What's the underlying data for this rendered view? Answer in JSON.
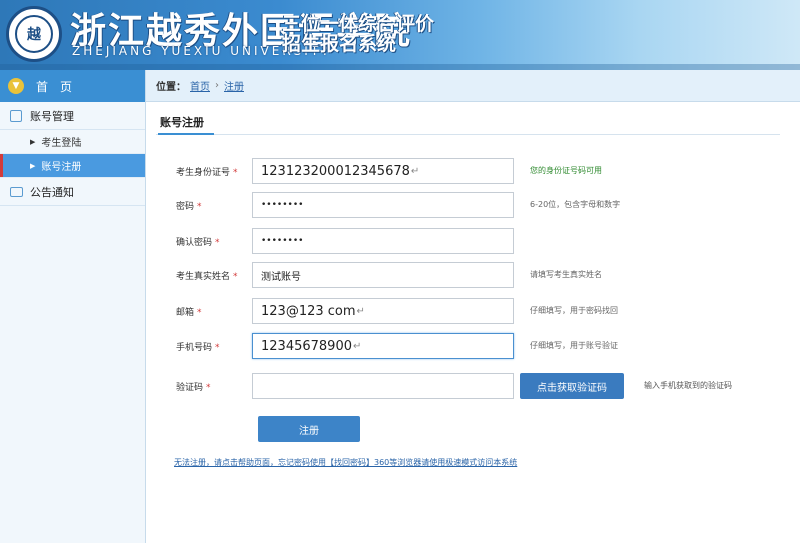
{
  "header": {
    "logo_text": "越",
    "school_cn": "浙江越秀外国语学院",
    "school_en": "ZHEJIANG YUEXIU UNIVERSITY",
    "system_title_line1": "三位一体综合评价",
    "system_title_line2": "招生报名系统"
  },
  "sidebar": {
    "home_label": "首页",
    "groups": [
      {
        "label": "账号管理",
        "items": [
          {
            "label": "考生登陆"
          },
          {
            "label": "账号注册"
          }
        ]
      },
      {
        "label": "公告通知"
      }
    ]
  },
  "breadcrumb": {
    "prefix": "位置：",
    "home": "首页",
    "sep": "›",
    "current": "注册"
  },
  "main": {
    "tab_title": "账号注册",
    "fields": [
      {
        "label": "考生身份证号",
        "value": "123123200012345678",
        "mark": "↵",
        "hint": "您的身份证号码可用"
      },
      {
        "label": "密码",
        "value": "••••••••",
        "hint": "6-20位，包含字母和数字"
      },
      {
        "label": "确认密码",
        "value": "••••••••",
        "hint": ""
      },
      {
        "label": "考生真实姓名",
        "value": "测试账号",
        "hint": "请填写考生真实姓名"
      },
      {
        "label": "邮箱",
        "value": "123@123 com",
        "mark": "↵",
        "hint": "仔细填写，用于密码找回"
      },
      {
        "label": "手机号码",
        "value": "12345678900",
        "mark": "↵",
        "hint": "仔细填写，用于账号验证"
      },
      {
        "label": "验证码",
        "value": "",
        "hint": "输入手机获取到的验证码"
      }
    ],
    "required_mark": "*",
    "get_code_button": "点击获取验证码",
    "submit_button": "注册",
    "footer_note": "无法注册，请点击帮助页面，忘记密码使用【找回密码】360等浏览器请使用极速模式访问本系统"
  }
}
